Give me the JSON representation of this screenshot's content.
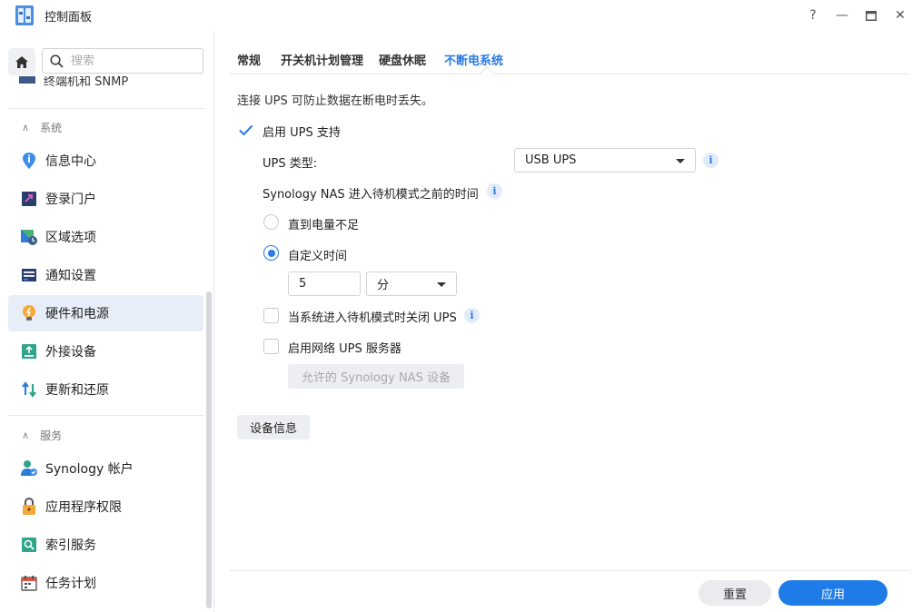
{
  "window": {
    "title": "控制面板",
    "buttons": {
      "help": "?",
      "minimize": "—",
      "maximize": "▭",
      "close": "✕"
    }
  },
  "sidebar": {
    "search_placeholder": "搜索",
    "cut_item": "终端机和 SNMP",
    "sections": [
      {
        "title": "系统",
        "items": [
          {
            "label": "信息中心",
            "icon": "info-center-icon"
          },
          {
            "label": "登录门户",
            "icon": "login-portal-icon"
          },
          {
            "label": "区域选项",
            "icon": "regional-options-icon"
          },
          {
            "label": "通知设置",
            "icon": "notification-icon"
          },
          {
            "label": "硬件和电源",
            "icon": "hardware-power-icon",
            "active": true
          },
          {
            "label": "外接设备",
            "icon": "external-devices-icon"
          },
          {
            "label": "更新和还原",
            "icon": "update-restore-icon"
          }
        ]
      },
      {
        "title": "服务",
        "items": [
          {
            "label": "Synology 帐户",
            "icon": "synology-account-icon"
          },
          {
            "label": "应用程序权限",
            "icon": "app-privileges-icon"
          },
          {
            "label": "索引服务",
            "icon": "indexing-service-icon"
          },
          {
            "label": "任务计划",
            "icon": "task-scheduler-icon"
          }
        ]
      }
    ]
  },
  "tabs": [
    {
      "label": "常规"
    },
    {
      "label": "开关机计划管理"
    },
    {
      "label": "硬盘休眠"
    },
    {
      "label": "不断电系统",
      "active": true
    }
  ],
  "ups": {
    "description": "连接 UPS 可防止数据在断电时丢失。",
    "enable_label": "启用 UPS 支持",
    "enable_checked": true,
    "type_label": "UPS 类型:",
    "type_value": "USB UPS",
    "standby_label": "Synology NAS 进入待机模式之前的时间",
    "radio_low_battery": "直到电量不足",
    "radio_custom": "自定义时间",
    "custom_selected": true,
    "custom_value": "5",
    "custom_unit": "分",
    "shutdown_ups_label": "当系统进入待机模式时关闭 UPS",
    "shutdown_ups_checked": false,
    "network_server_label": "启用网络 UPS 服务器",
    "network_server_checked": false,
    "allowed_devices_button": "允许的 Synology NAS 设备",
    "device_info_button": "设备信息"
  },
  "footer": {
    "reset": "重置",
    "apply": "应用"
  },
  "colors": {
    "accent": "#1e7be7",
    "active_nav_bg": "#e8eef7"
  }
}
